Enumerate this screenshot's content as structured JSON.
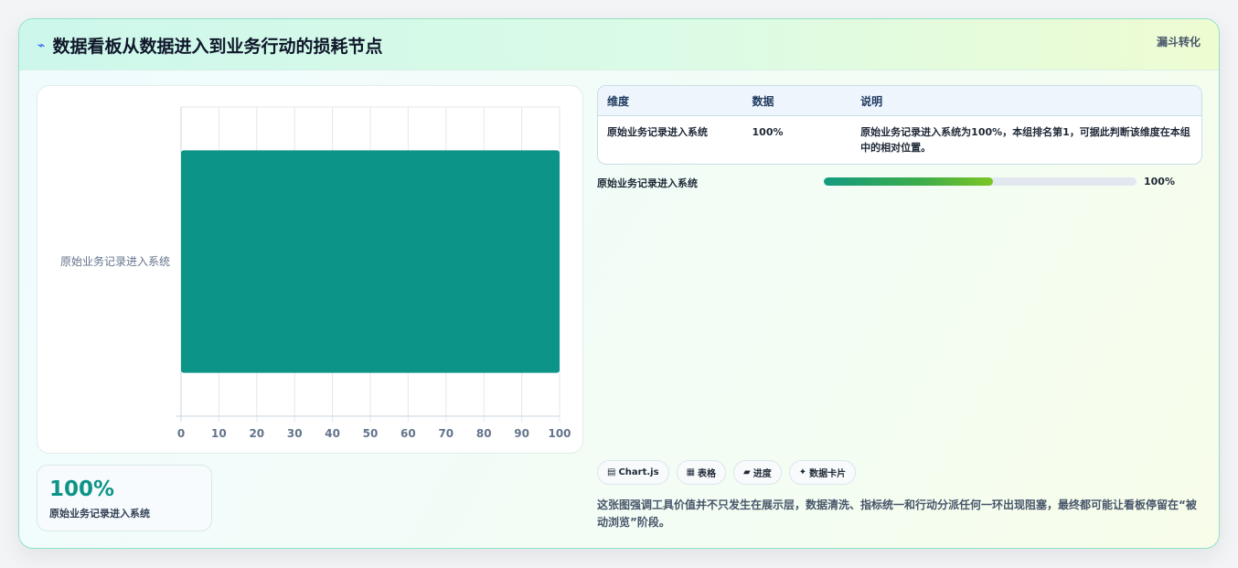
{
  "header": {
    "title": "数据看板从数据进入到业务行动的损耗节点",
    "tag": "漏斗转化",
    "accent": "#0d9488"
  },
  "chart_data": {
    "type": "bar",
    "orientation": "horizontal",
    "categories": [
      "原始业务记录进入系统"
    ],
    "values": [
      100
    ],
    "xlim": [
      0,
      100
    ],
    "xticks": [
      0,
      10,
      20,
      30,
      40,
      50,
      60,
      70,
      80,
      90,
      100
    ],
    "grid": true,
    "bar_color": "#0c9488"
  },
  "stat": {
    "value": "100%",
    "label": "原始业务记录进入系统"
  },
  "table": {
    "headers": [
      "维度",
      "数据",
      "说明"
    ],
    "rows": [
      [
        "原始业务记录进入系统",
        "100%",
        "原始业务记录进入系统为100%，本组排名第1，可据此判断该维度在本组中的相对位置。"
      ]
    ]
  },
  "progress": [
    {
      "label": "原始业务记录进入系统",
      "value_text": "100%",
      "fill": 0.54
    }
  ],
  "tags": [
    {
      "icon": "▤",
      "label": "Chart.js"
    },
    {
      "icon": "▦",
      "label": "表格"
    },
    {
      "icon": "▰",
      "label": "进度"
    },
    {
      "icon": "✦",
      "label": "数据卡片"
    }
  ],
  "footnote": "这张图强调工具价值并不只发生在展示层，数据清洗、指标统一和行动分派任何一环出现阻塞，最终都可能让看板停留在“被动浏览”阶段。"
}
